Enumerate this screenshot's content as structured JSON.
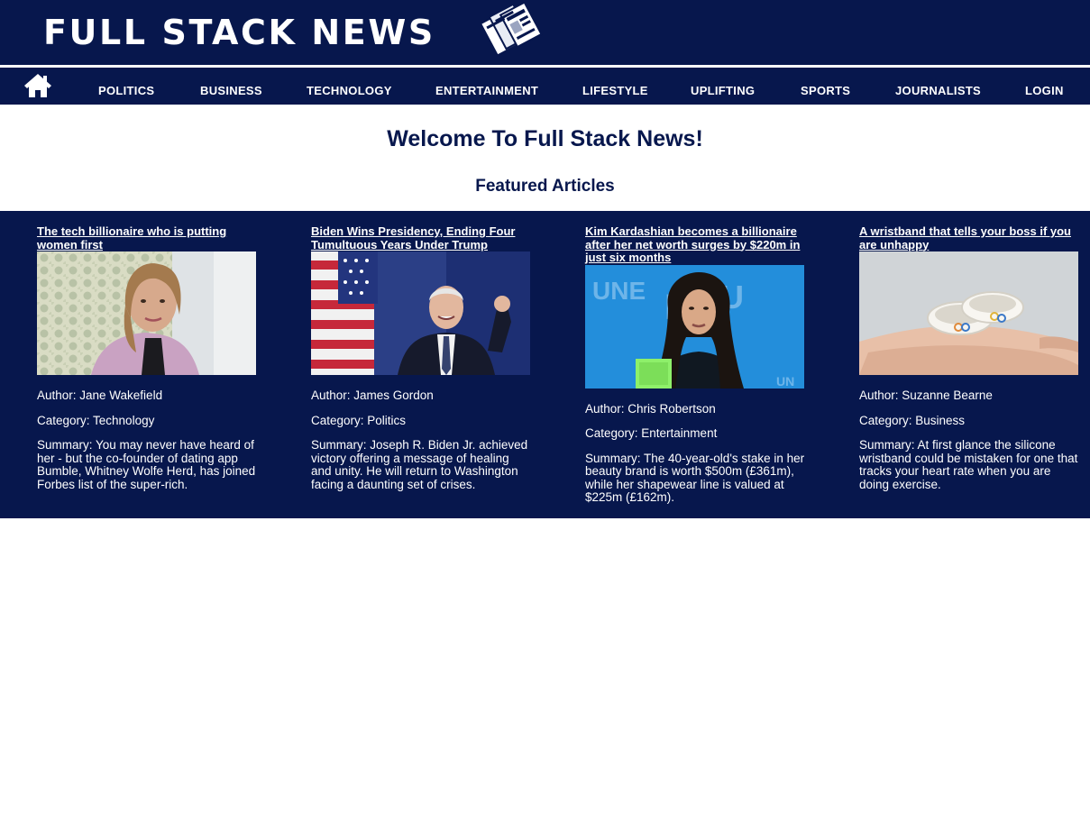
{
  "header": {
    "logo_text": "FULL STACK NEWS",
    "logo_icon": "newspapers-icon",
    "home_icon": "home-icon"
  },
  "nav": {
    "items": [
      "POLITICS",
      "BUSINESS",
      "TECHNOLOGY",
      "ENTERTAINMENT",
      "LIFESTYLE",
      "UPLIFTING",
      "SPORTS",
      "JOURNALISTS",
      "LOGIN"
    ]
  },
  "main": {
    "welcome": "Welcome To Full Stack News!",
    "featured_heading": "Featured Articles"
  },
  "articles": [
    {
      "title": "The tech billionaire who is putting women first",
      "image": "woman-portrait-photo",
      "author": "Author: Jane Wakefield",
      "category": "Category: Technology",
      "summary": "Summary: You may never have heard of her - but the co-founder of dating app Bumble, Whitney Wolfe Herd, has joined Forbes list of the super-rich."
    },
    {
      "title": "Biden Wins Presidency, Ending Four Tumultuous Years Under Trump",
      "image": "biden-flag-photo",
      "author": "Author: James Gordon",
      "category": "Category: Politics",
      "summary": "Summary: Joseph R. Biden Jr. achieved victory offering a message of healing and unity. He will return to Washington facing a daunting set of crises."
    },
    {
      "title": "Kim Kardashian becomes a billionaire after her net worth surges by $220m in just six months",
      "image": "kardashian-blue-backdrop-photo",
      "author": "Author: Chris Robertson",
      "category": "Category: Entertainment",
      "summary": "Summary: The 40-year-old's stake in her beauty brand is worth $500m (£361m), while her shapewear line is valued at $225m (£162m)."
    },
    {
      "title": "A wristband that tells your boss if you are unhappy",
      "image": "wristbands-in-hand-photo",
      "author": "Author: Suzanne Bearne",
      "category": "Category: Business",
      "summary": "Summary: At first glance the silicone wristband could be mistaken for one that tracks your heart rate when you are doing exercise."
    }
  ],
  "colors": {
    "brand_navy": "#07174d",
    "text_light": "#ffffff"
  }
}
